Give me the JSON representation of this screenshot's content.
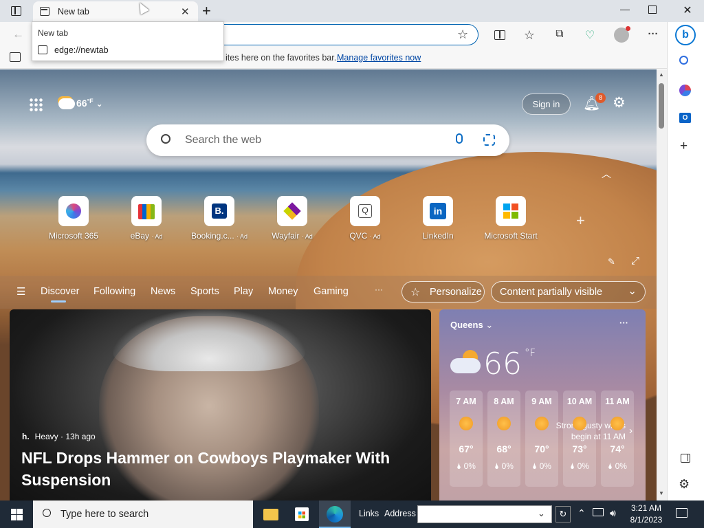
{
  "browser": {
    "tab_title": "New tab",
    "tooltip_title": "New tab",
    "tooltip_url": "edge://newtab",
    "favorites_text": "ites here on the favorites bar.",
    "favorites_link": "Manage favorites now"
  },
  "top": {
    "weather_temp": "66",
    "weather_unit": "°F",
    "sign_in": "Sign in",
    "notifications": "8",
    "search_placeholder": "Search the web"
  },
  "tiles": [
    {
      "label": "Microsoft 365",
      "ad": ""
    },
    {
      "label": "eBay",
      "ad": "· Ad"
    },
    {
      "label": "Booking.c...",
      "ad": "· Ad"
    },
    {
      "label": "Wayfair",
      "ad": "· Ad"
    },
    {
      "label": "QVC",
      "ad": "· Ad"
    },
    {
      "label": "LinkedIn",
      "ad": ""
    },
    {
      "label": "Microsoft Start",
      "ad": ""
    }
  ],
  "nav": {
    "items": [
      "Discover",
      "Following",
      "News",
      "Sports",
      "Play",
      "Money",
      "Gaming"
    ],
    "more": "···",
    "personalize": "Personalize",
    "content_visibility": "Content partially visible"
  },
  "hero": {
    "source": "Heavy · 13h ago",
    "headline": "NFL Drops Hammer on Cowboys Playmaker With Suspension"
  },
  "weather": {
    "location": "Queens",
    "temp": "66",
    "unit": "°F",
    "alert_line1": "Strong gusty winds",
    "alert_line2": "begin at 11 AM",
    "hours": [
      {
        "time": "7 AM",
        "temp": "67°",
        "precip": "0%"
      },
      {
        "time": "8 AM",
        "temp": "68°",
        "precip": "0%"
      },
      {
        "time": "9 AM",
        "temp": "70°",
        "precip": "0%"
      },
      {
        "time": "10 AM",
        "temp": "73°",
        "precip": "0%"
      },
      {
        "time": "11 AM",
        "temp": "74°",
        "precip": "0%"
      }
    ]
  },
  "taskbar": {
    "search_placeholder": "Type here to search",
    "links": "Links",
    "address": "Address",
    "time": "3:21 AM",
    "date": "8/1/2023"
  }
}
